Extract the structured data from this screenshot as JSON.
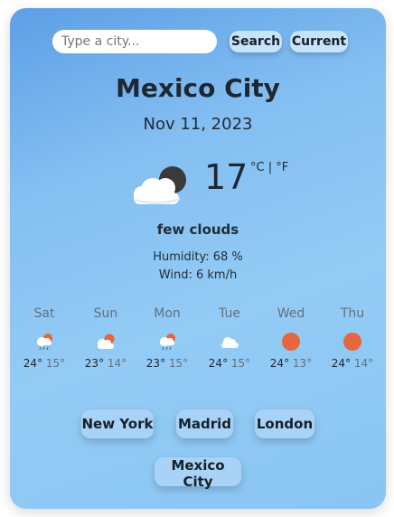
{
  "search": {
    "placeholder": "Type a city...",
    "value": ""
  },
  "buttons": {
    "search_label": "Search",
    "current_label": "Current"
  },
  "current": {
    "city": "Mexico City",
    "date": "Nov 11, 2023",
    "temperature": "17",
    "unit_c": "°C",
    "unit_sep": "|",
    "unit_f": "°F",
    "description": "few clouds",
    "humidity": "Humidity: 68 %",
    "wind": "Wind: 6 km/h",
    "icon": "few-clouds-night-icon"
  },
  "forecast": [
    {
      "day": "Sat",
      "max": "24°",
      "min": "15°",
      "icon": "rain-sun-icon"
    },
    {
      "day": "Sun",
      "max": "23°",
      "min": "14°",
      "icon": "cloud-sun-icon"
    },
    {
      "day": "Mon",
      "max": "23°",
      "min": "15°",
      "icon": "rain-sun-icon"
    },
    {
      "day": "Tue",
      "max": "24°",
      "min": "15°",
      "icon": "cloud-icon"
    },
    {
      "day": "Wed",
      "max": "24°",
      "min": "13°",
      "icon": "sun-icon"
    },
    {
      "day": "Thu",
      "max": "24°",
      "min": "14°",
      "icon": "sun-icon"
    }
  ],
  "cities": [
    "New York",
    "Madrid",
    "London",
    "Mexico City"
  ],
  "colors": {
    "card_top": "#5d9fe6",
    "card_bottom": "#8ac6f3",
    "sun": "#e5673f",
    "button": "#a9d3f6"
  }
}
